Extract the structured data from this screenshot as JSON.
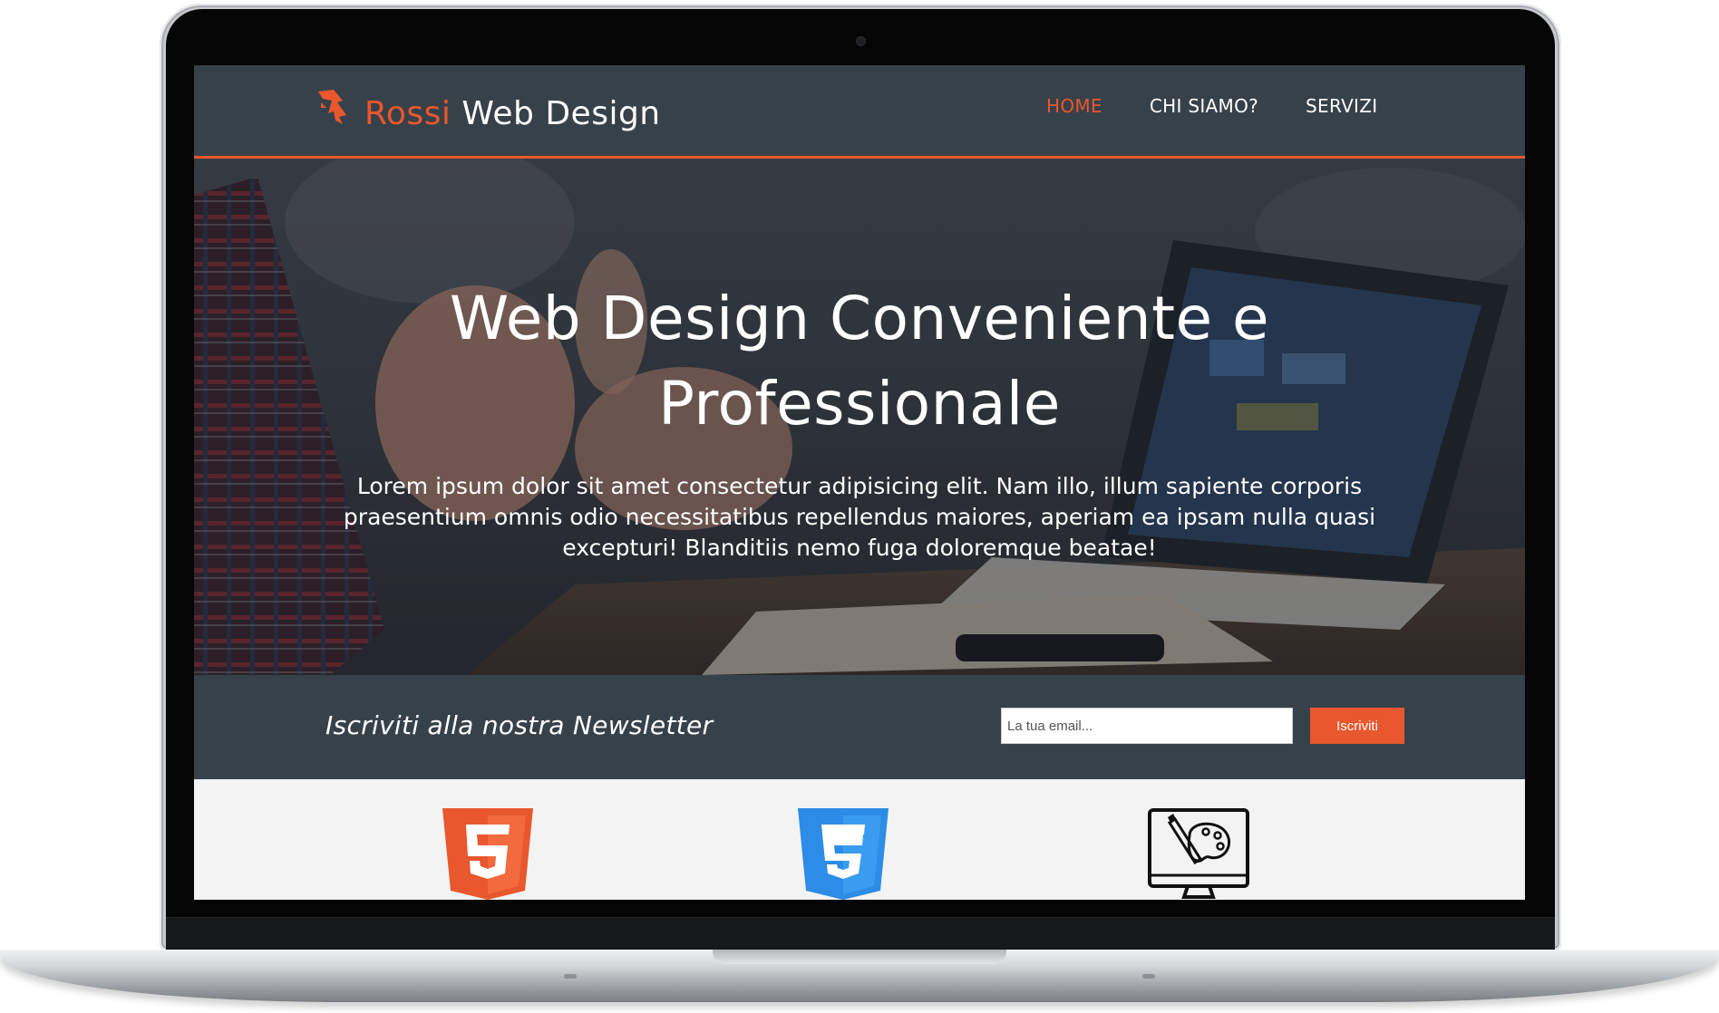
{
  "brand": {
    "name_part1": "Rossi",
    "name_part2": "Web Design",
    "logo_icon": "arrow-logo-icon",
    "accent_color": "#e8572e",
    "nav_bg_color": "#37414a"
  },
  "nav": {
    "items": [
      {
        "label": "HOME",
        "active": true
      },
      {
        "label": "CHI SIAMO?",
        "active": false
      },
      {
        "label": "SERVIZI",
        "active": false
      }
    ]
  },
  "hero": {
    "title_line1": "Web Design Conveniente e",
    "title_line2": "Professionale",
    "text": "Lorem ipsum dolor sit amet consectetur adipisicing elit. Nam illo, illum sapiente corporis praesentium omnis odio necessitatibus repellendus maiores, aperiam ea ipsam nulla quasi excepturi! Blanditiis nemo fuga doloremque beatae!"
  },
  "newsletter": {
    "title": "Iscriviti alla nostra Newsletter",
    "input_placeholder": "La tua email...",
    "button_label": "Iscriviti"
  },
  "features": {
    "icons": [
      "html5-icon",
      "css3-icon",
      "design-monitor-icon"
    ],
    "html5_color": "#e8572e",
    "css3_color": "#2c8ce6"
  }
}
